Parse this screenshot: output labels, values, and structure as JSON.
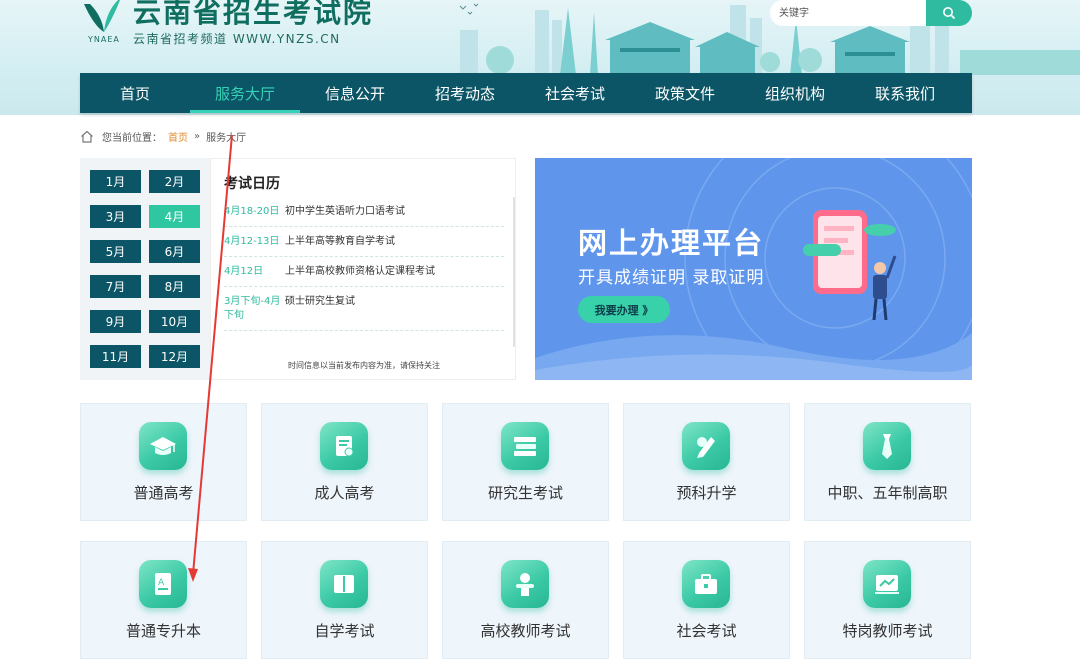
{
  "header": {
    "title": "云南省招生考试院",
    "subtitle": "云南省招考频道 WWW.YNZS.CN",
    "logo_abbr": "YNAEA",
    "search_placeholder": "关键字"
  },
  "nav": {
    "items": [
      {
        "label": "首页"
      },
      {
        "label": "服务大厅"
      },
      {
        "label": "信息公开"
      },
      {
        "label": "招考动态"
      },
      {
        "label": "社会考试"
      },
      {
        "label": "政策文件"
      },
      {
        "label": "组织机构"
      },
      {
        "label": "联系我们"
      }
    ],
    "active": "服务大厅"
  },
  "breadcrumb": {
    "prefix": "您当前位置：",
    "home": "首页",
    "separator": "»",
    "current": "服务大厅"
  },
  "calendar": {
    "months": [
      "1月",
      "2月",
      "3月",
      "4月",
      "5月",
      "6月",
      "7月",
      "8月",
      "9月",
      "10月",
      "11月",
      "12月"
    ],
    "active_month": "4月",
    "title": "考试日历",
    "events": [
      {
        "date": "4月18-20日",
        "name": "初中学生英语听力口语考试"
      },
      {
        "date": "4月12-13日",
        "name": "上半年高等教育自学考试"
      },
      {
        "date": "4月12日",
        "name": "上半年高校教师资格认定课程考试"
      },
      {
        "date": "3月下旬-4月下旬",
        "name": "硕士研究生复试"
      }
    ],
    "note": "时间信息以当前发布内容为准，请保持关注"
  },
  "promo": {
    "title": "网上办理平台",
    "subtitle": "开具成绩证明 录取证明",
    "button": "我要办理 》"
  },
  "categories": [
    {
      "label": "普通高考",
      "icon": "graduation-cap-icon"
    },
    {
      "label": "成人高考",
      "icon": "certificate-icon"
    },
    {
      "label": "研究生考试",
      "icon": "books-stack-icon"
    },
    {
      "label": "预科升学",
      "icon": "pencil-eraser-icon"
    },
    {
      "label": "中职、五年制高职",
      "icon": "necktie-icon"
    },
    {
      "label": "普通专升本",
      "icon": "exam-paper-icon"
    },
    {
      "label": "自学考试",
      "icon": "open-book-icon"
    },
    {
      "label": "高校教师考试",
      "icon": "teacher-icon"
    },
    {
      "label": "社会考试",
      "icon": "briefcase-icon"
    },
    {
      "label": "特岗教师考试",
      "icon": "chalkboard-icon"
    }
  ],
  "colors": {
    "nav_bg": "#0b5566",
    "accent": "#2fbba0",
    "promo_bg": "#5f96ec",
    "annotation_arrow": "#e53935"
  }
}
